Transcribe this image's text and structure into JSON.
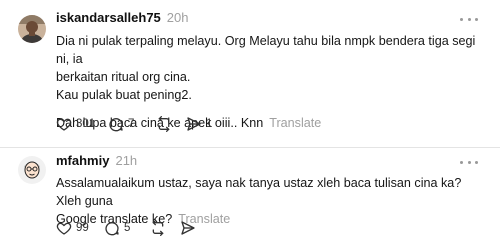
{
  "posts": [
    {
      "username": "iskandarsalleh75",
      "time": "20h",
      "lines": [
        "Dia ni pulak terpaling melayu. Org Melayu tahu bila nmpk bendera tiga segi ni, ia",
        "berkaitan ritual org cina.",
        "Kau pulak buat pening2."
      ],
      "last_line": "Dah lupa baca cina ke apek oiii.. Knn",
      "translate": "Translate",
      "likes": "301",
      "replies": "7",
      "reposts": "",
      "shares": "1"
    },
    {
      "username": "mfahmiy",
      "time": "21h",
      "lines": [
        "Assalamualaikum ustaz, saya nak tanya ustaz xleh baca tulisan cina ka? Xleh guna"
      ],
      "last_line": "Google translate ke?",
      "translate": "Translate",
      "likes": "99",
      "replies": "5",
      "reposts": "",
      "shares": ""
    }
  ],
  "icons": {
    "more": "more-dots-icon",
    "like": "heart-icon",
    "reply": "comment-icon",
    "repost": "repost-icon",
    "share": "share-icon"
  }
}
